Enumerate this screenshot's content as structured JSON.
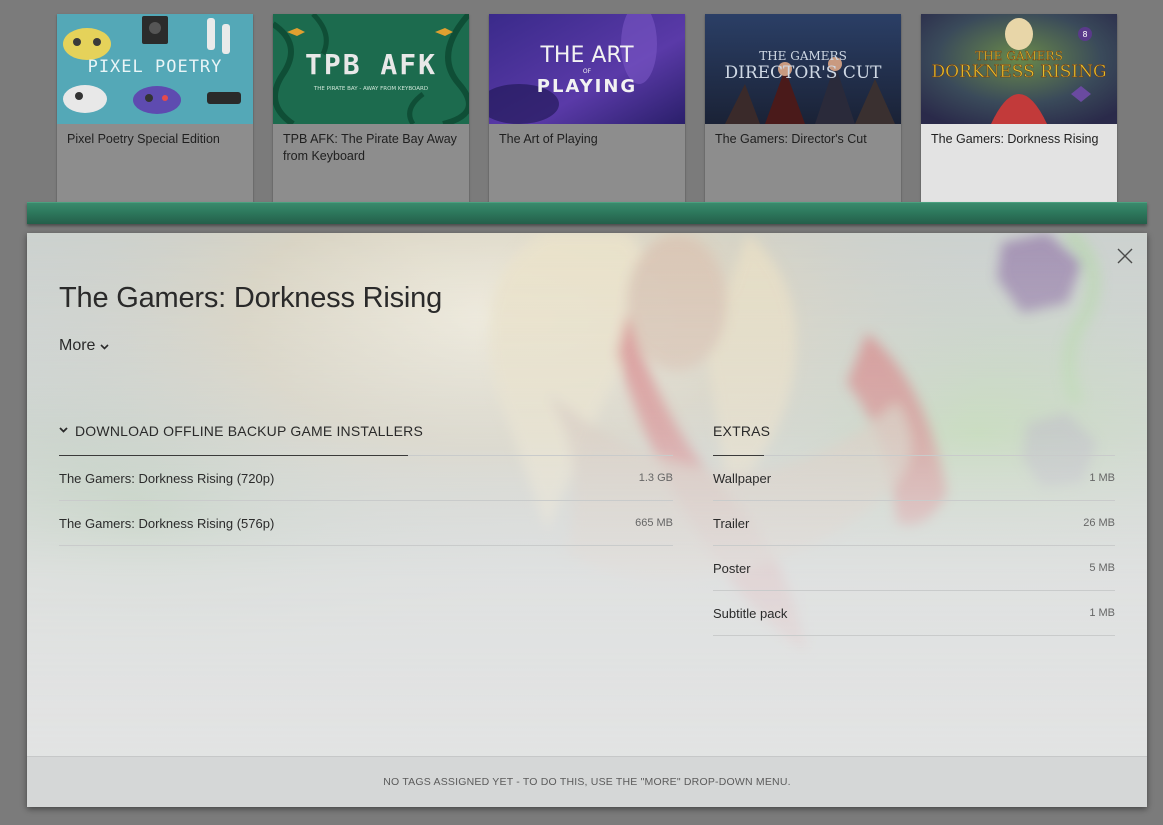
{
  "shelf": {
    "games": [
      {
        "title": "Pixel Poetry Special Edition",
        "cover_text": "PIXEL POETRY",
        "active": false
      },
      {
        "title": "TPB AFK: The Pirate Bay Away from Keyboard",
        "cover_text": "TPB AFK",
        "cover_subtext": "THE PIRATE BAY - AWAY FROM KEYBOARD",
        "active": false
      },
      {
        "title": "The Art of Playing",
        "cover_text_1": "THE ART",
        "cover_text_2": "OF",
        "cover_text_3": "PLAYING",
        "active": false
      },
      {
        "title": "The Gamers: Director's Cut",
        "cover_text_1": "THE GAMERS",
        "cover_text_2": "DIRECTOR'S CUT",
        "active": false
      },
      {
        "title": "The Gamers: Dorkness Rising",
        "cover_text_1": "THE GAMERS",
        "cover_text_2": "DORKNESS RISING",
        "active": true
      }
    ]
  },
  "panel": {
    "title": "The Gamers: Dorkness Rising",
    "more_label": "More",
    "downloads": {
      "heading": "DOWNLOAD OFFLINE BACKUP GAME INSTALLERS",
      "items": [
        {
          "name": "The Gamers: Dorkness Rising (720p)",
          "size": "1.3 GB"
        },
        {
          "name": "The Gamers: Dorkness Rising (576p)",
          "size": "665 MB"
        }
      ]
    },
    "extras": {
      "heading": "EXTRAS",
      "items": [
        {
          "name": "Wallpaper",
          "size": "1 MB"
        },
        {
          "name": "Trailer",
          "size": "26 MB"
        },
        {
          "name": "Poster",
          "size": "5 MB"
        },
        {
          "name": "Subtitle pack",
          "size": "1 MB"
        }
      ]
    },
    "footer_text": "NO TAGS ASSIGNED YET - TO DO THIS, USE THE \"MORE\" DROP-DOWN MENU."
  },
  "colors": {
    "shelf_bar": "#2e7a5e",
    "page_bg": "#7b7b7b",
    "panel_bg": "#dcdedd"
  }
}
